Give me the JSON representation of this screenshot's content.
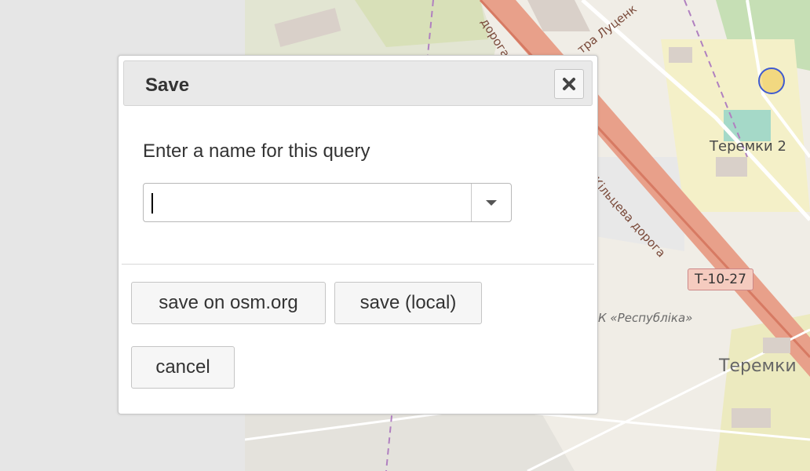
{
  "map": {
    "labels": {
      "district_1": "Теремки 2",
      "district_2": "Теремки",
      "poi": "К «Республіка»",
      "road_1": "Кільцева дорога",
      "road_2": "дорога",
      "road_3": "тра Луценк",
      "route_shield": "Т-10-27"
    },
    "marker_color": "#3f5bd0"
  },
  "dialog": {
    "title": "Save",
    "close_icon": "close-icon",
    "prompt": "Enter a name for this query",
    "name_input_value": "",
    "buttons": {
      "save_osm": "save on osm.org",
      "save_local": "save (local)",
      "cancel": "cancel"
    }
  }
}
